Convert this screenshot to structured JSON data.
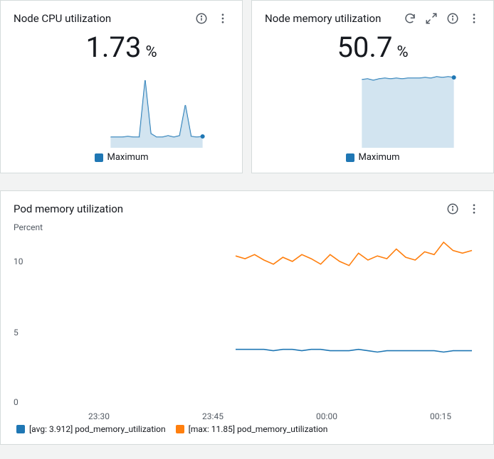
{
  "cpu_card": {
    "title": "Node CPU utilization",
    "value": "1.73",
    "unit": "%",
    "legend": "Maximum",
    "color": "#1f77b4"
  },
  "mem_card": {
    "title": "Node memory utilization",
    "value": "50.7",
    "unit": "%",
    "legend": "Maximum",
    "color": "#1f77b4"
  },
  "pod_card": {
    "title": "Pod memory utilization",
    "ylabel": "Percent"
  },
  "legend_entries": {
    "avg_label": "[avg: 3.912] pod_memory_utilization",
    "max_label": "[max: 11.85] pod_memory_utilization",
    "avg_color": "#1f77b4",
    "max_color": "#ff7f0e"
  },
  "chart_data": [
    {
      "type": "line-area",
      "title": "Node CPU utilization",
      "ylabel": "Percent",
      "series": [
        {
          "name": "Maximum",
          "color": "#1f77b4",
          "values": [
            1.7,
            1.7,
            1.7,
            1.8,
            1.7,
            1.7,
            8.5,
            2.2,
            1.7,
            1.7,
            2.0,
            1.7,
            2.0,
            5.5,
            1.8,
            1.7,
            1.73
          ]
        }
      ],
      "ylim": [
        0,
        10
      ]
    },
    {
      "type": "line-area",
      "title": "Node memory utilization",
      "ylabel": "Percent",
      "series": [
        {
          "name": "Maximum",
          "color": "#1f77b4",
          "values": [
            50.2,
            50.4,
            50.0,
            50.3,
            50.6,
            50.4,
            50.5,
            50.3,
            50.4,
            50.6,
            50.5,
            50.7,
            50.6,
            50.9,
            50.7,
            51.0,
            50.7
          ]
        }
      ],
      "ylim": [
        0,
        55
      ]
    },
    {
      "type": "line",
      "title": "Pod memory utilization",
      "xlabel": "",
      "ylabel": "Percent",
      "x_ticks": [
        "23:30",
        "23:45",
        "00:00",
        "00:15"
      ],
      "ylim": [
        0,
        12
      ],
      "y_ticks": [
        0,
        5,
        10
      ],
      "series": [
        {
          "name": "[avg: 3.912] pod_memory_utilization",
          "color": "#1f77b4",
          "values": [
            4.0,
            4.0,
            4.0,
            4.0,
            3.9,
            4.0,
            4.0,
            3.9,
            4.0,
            4.0,
            3.9,
            3.9,
            3.9,
            4.0,
            3.9,
            3.8,
            3.9,
            3.9,
            3.9,
            3.9,
            3.9,
            3.9,
            3.8,
            3.9,
            3.9,
            3.9
          ]
        },
        {
          "name": "[max: 11.85] pod_memory_utilization",
          "color": "#ff7f0e",
          "values": [
            10.8,
            10.6,
            10.9,
            10.5,
            10.2,
            10.7,
            10.4,
            10.9,
            10.6,
            10.2,
            10.9,
            10.4,
            10.1,
            11.0,
            10.5,
            10.8,
            10.6,
            11.3,
            10.7,
            10.5,
            11.1,
            10.9,
            11.8,
            11.2,
            11.0,
            11.2
          ]
        }
      ]
    }
  ]
}
